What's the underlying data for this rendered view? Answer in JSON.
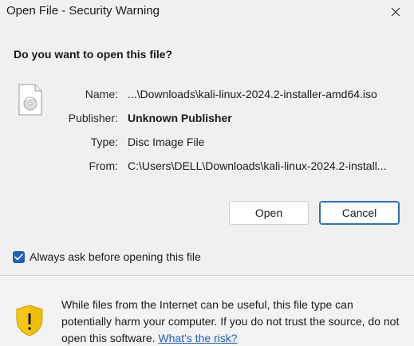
{
  "window": {
    "title": "Open File - Security Warning",
    "close_icon": "close-icon"
  },
  "prompt": {
    "question": "Do you want to open this file?"
  },
  "file": {
    "icon": "disc-image-file-icon",
    "name_label": "Name:",
    "name_value": "...\\Downloads\\kali-linux-2024.2-installer-amd64.iso",
    "publisher_label": "Publisher:",
    "publisher_value": "Unknown Publisher",
    "type_label": "Type:",
    "type_value": "Disc Image File",
    "from_label": "From:",
    "from_value": "C:\\Users\\DELL\\Downloads\\kali-linux-2024.2-install..."
  },
  "buttons": {
    "open_label": "Open",
    "cancel_label": "Cancel"
  },
  "options": {
    "always_ask_label": "Always ask before opening this file",
    "always_ask_checked": true
  },
  "footer": {
    "icon": "warning-shield-icon",
    "warning_text": "While files from the Internet can be useful, this file type can potentially harm your computer. If you do not trust the source, do not open this software.",
    "link_text": "What's the risk?"
  },
  "colors": {
    "accent": "#1f62b3",
    "link": "#1f5fb5",
    "shield_yellow": "#f5c518"
  }
}
